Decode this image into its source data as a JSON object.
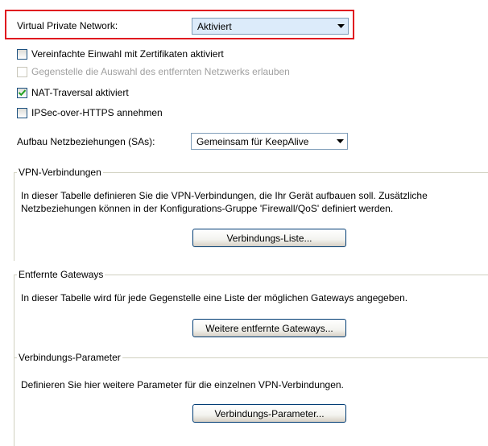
{
  "vpn": {
    "label": "Virtual Private Network:",
    "value": "Aktiviert"
  },
  "checkboxes": [
    {
      "label": "Vereinfachte Einwahl mit Zertifikaten aktiviert",
      "checked": false,
      "disabled": false
    },
    {
      "label": "Gegenstelle die Auswahl des entfernten Netzwerks erlauben",
      "checked": false,
      "disabled": true
    },
    {
      "label": "NAT-Traversal aktiviert",
      "checked": true,
      "disabled": false
    },
    {
      "label": "IPSec-over-HTTPS annehmen",
      "checked": false,
      "disabled": false
    }
  ],
  "sa": {
    "label": "Aufbau Netzbeziehungen (SAs):",
    "value": "Gemeinsam für KeepAlive"
  },
  "groups": [
    {
      "legend": "VPN-Verbindungen",
      "description_line1": "In dieser Tabelle definieren Sie die VPN-Verbindungen, die Ihr Gerät aufbauen soll. Zusätzliche",
      "description_line2": "Netzbeziehungen können in der Konfigurations-Gruppe 'Firewall/QoS' definiert werden.",
      "button": "Verbindungs-Liste..."
    },
    {
      "legend": "Entfernte Gateways",
      "description_line1": "In dieser Tabelle wird für jede Gegenstelle eine Liste der möglichen Gateways angegeben.",
      "button": "Weitere entfernte Gateways..."
    },
    {
      "legend": "Verbindungs-Parameter",
      "description_line1": "Definieren Sie hier weitere Parameter für die einzelnen VPN-Verbindungen.",
      "button": "Verbindungs-Parameter..."
    }
  ],
  "colors": {
    "highlight": "#e0171f",
    "selected_bg": "#dcebfa",
    "check": "#21a121"
  }
}
